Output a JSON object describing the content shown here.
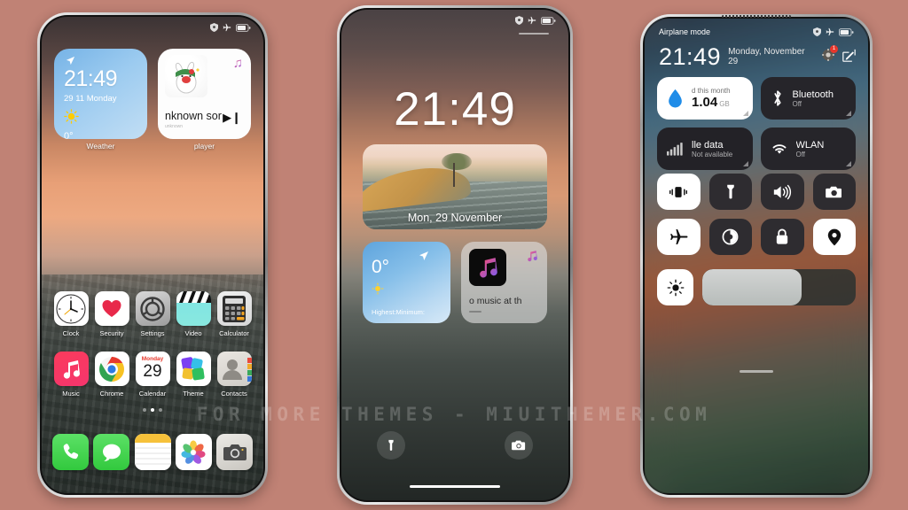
{
  "background_color": "#c08275",
  "watermark": "FOR MORE THEMES - MIUITHEMER.COM",
  "home_screen": {
    "status_icons": [
      "shield-icon",
      "airplane-icon",
      "battery-icon"
    ],
    "widgets": {
      "weather": {
        "label": "Weather",
        "time": "21:49",
        "date": "29 11 Monday",
        "temp": "0°",
        "condition_icon": "sun-icon"
      },
      "player": {
        "label": "player",
        "title": "nknown sor",
        "subtitle": "unknown",
        "note_icon": "music-note-icon",
        "play_icon": "play-next-icon"
      }
    },
    "apps_row1": [
      {
        "name": "Clock",
        "icon": "clock-icon"
      },
      {
        "name": "Security",
        "icon": "heart-shield-icon"
      },
      {
        "name": "Settings",
        "icon": "gear-icon"
      },
      {
        "name": "Video",
        "icon": "clapperboard-icon"
      },
      {
        "name": "Calculator",
        "icon": "calculator-icon"
      }
    ],
    "apps_row2": [
      {
        "name": "Music",
        "icon": "music-note-icon"
      },
      {
        "name": "Chrome",
        "icon": "chrome-icon"
      },
      {
        "name": "Calendar",
        "icon": "calendar-icon",
        "day_name": "Monday",
        "day_num": "29"
      },
      {
        "name": "Theme",
        "icon": "theme-shapes-icon"
      },
      {
        "name": "Contacts",
        "icon": "person-icon"
      }
    ],
    "page_dots": {
      "count": 3,
      "active_index": 1
    },
    "dock": [
      {
        "name": "Phone",
        "icon": "phone-icon"
      },
      {
        "name": "Messages",
        "icon": "message-bubble-icon"
      },
      {
        "name": "Notes",
        "icon": "notes-icon"
      },
      {
        "name": "Photos",
        "icon": "photos-flower-icon"
      },
      {
        "name": "Camera",
        "icon": "camera-icon"
      }
    ]
  },
  "lock_screen": {
    "status_icons": [
      "shield-icon",
      "airplane-icon",
      "battery-icon"
    ],
    "time": "21:49",
    "photo_date": "Mon, 29 November",
    "widgets": {
      "weather": {
        "temp": "0°",
        "minmax_label": "Highest:Minimum:",
        "nav_icon": "navigation-arrow-icon",
        "condition_icon": "sun-icon"
      },
      "music": {
        "title": "o music at th",
        "note_icon": "music-note-icon",
        "art_icon": "music-note-icon"
      }
    },
    "actions": [
      {
        "name": "Flashlight",
        "icon": "flashlight-icon"
      },
      {
        "name": "Camera",
        "icon": "camera-icon"
      }
    ]
  },
  "control_center": {
    "status_left": "Airplane mode",
    "status_icons": [
      "shield-icon",
      "airplane-icon",
      "battery-icon"
    ],
    "time": "21:49",
    "date": "Monday, November 29",
    "header_icons": [
      {
        "name": "settings-gear-icon",
        "badge": "1"
      },
      {
        "name": "edit-pencil-icon",
        "badge": ""
      }
    ],
    "big_tiles": [
      {
        "id": "data-usage",
        "title": "d this month",
        "value": "1.04",
        "unit": "GB",
        "icon": "data-drop-icon",
        "state": "light"
      },
      {
        "id": "bluetooth",
        "title": "Bluetooth",
        "sub": "Off",
        "icon": "bluetooth-icon",
        "state": "dark"
      },
      {
        "id": "mobile-data",
        "title": "lle data",
        "sub": "Not available",
        "icon": "signal-bars-icon",
        "state": "dark"
      },
      {
        "id": "wlan",
        "title": "WLAN",
        "sub": "Off",
        "icon": "wifi-icon",
        "state": "dark"
      }
    ],
    "small_tiles": [
      {
        "id": "vibrate",
        "icon": "vibrate-icon",
        "state": "on"
      },
      {
        "id": "flashlight",
        "icon": "flashlight-icon",
        "state": "off"
      },
      {
        "id": "volume",
        "icon": "speaker-icon",
        "state": "off"
      },
      {
        "id": "screenshot",
        "icon": "camera-icon",
        "state": "off"
      },
      {
        "id": "airplane",
        "icon": "airplane-icon",
        "state": "on"
      },
      {
        "id": "dark-mode",
        "icon": "contrast-icon",
        "state": "off"
      },
      {
        "id": "lock",
        "icon": "lock-icon",
        "state": "off"
      },
      {
        "id": "location",
        "icon": "location-pin-icon",
        "state": "on"
      }
    ],
    "brightness": {
      "icon": "brightness-sun-icon",
      "percent": 65
    }
  }
}
